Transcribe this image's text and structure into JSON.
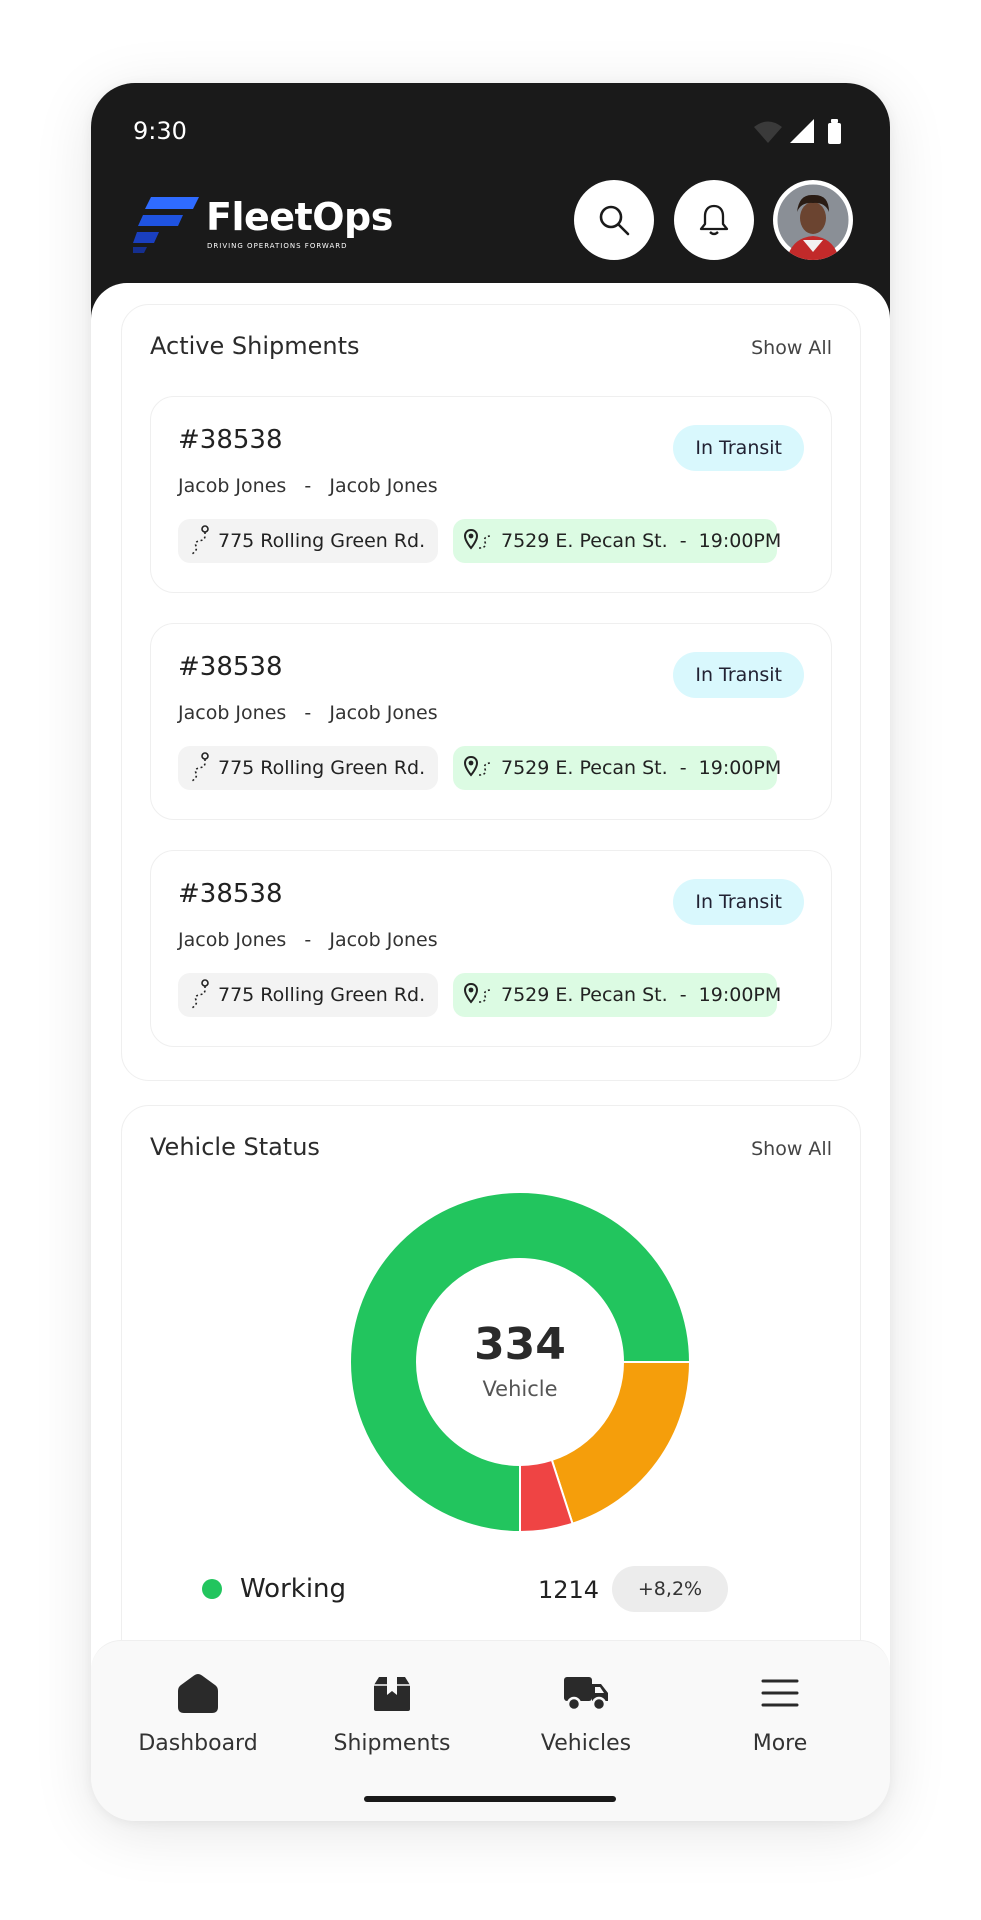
{
  "status_bar": {
    "time": "9:30"
  },
  "header": {
    "brand": "FleetOps",
    "tagline": "DRIVING OPERATIONS FORWARD",
    "brand_color": "#1a4fd6"
  },
  "active_shipments": {
    "title": "Active Shipments",
    "show_all": "Show All",
    "items": [
      {
        "id": "#38538",
        "names": "Jacob Jones   -   Jacob Jones",
        "status": "In Transit",
        "from": "775 Rolling Green Rd.",
        "to": "7529 E. Pecan St.  -  19:00PM"
      },
      {
        "id": "#38538",
        "names": "Jacob Jones   -   Jacob Jones",
        "status": "In Transit",
        "from": "775 Rolling Green Rd.",
        "to": "7529 E. Pecan St.  -  19:00PM"
      },
      {
        "id": "#38538",
        "names": "Jacob Jones   -   Jacob Jones",
        "status": "In Transit",
        "from": "775 Rolling Green Rd.",
        "to": "7529 E. Pecan St.  -  19:00PM"
      }
    ]
  },
  "vehicle_status": {
    "title": "Vehicle Status",
    "show_all": "Show All",
    "total": "334",
    "total_label": "Vehicle",
    "legend": [
      {
        "name": "Working",
        "count": "1214",
        "change": "+8,2%",
        "color": "#22c55e"
      }
    ]
  },
  "chart_data": {
    "type": "pie",
    "donut": true,
    "slices": [
      {
        "value": 75,
        "color": "#22c55e"
      },
      {
        "value": 5,
        "color": "#ef4444"
      },
      {
        "value": 20,
        "color": "#f59e0b"
      }
    ]
  },
  "bottom_nav": [
    {
      "label": "Dashboard",
      "icon": "home-icon"
    },
    {
      "label": "Shipments",
      "icon": "box-icon"
    },
    {
      "label": "Vehicles",
      "icon": "truck-icon"
    },
    {
      "label": "More",
      "icon": "menu-icon"
    }
  ]
}
